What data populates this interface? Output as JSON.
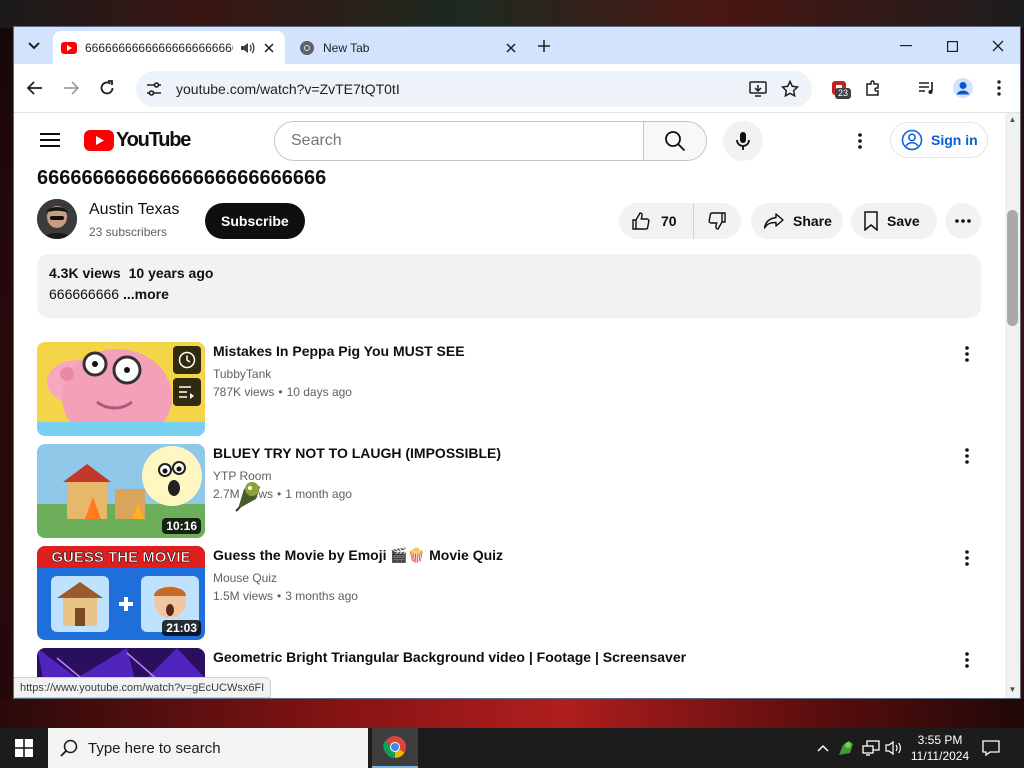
{
  "browser": {
    "tabs": [
      {
        "title": "66666666666666666666666666",
        "active": true,
        "audio": true
      },
      {
        "title": "New Tab",
        "active": false
      }
    ],
    "url": "youtube.com/watch?v=ZvTE7tQT0tI",
    "extension_badge": "23",
    "status_url": "https://www.youtube.com/watch?v=gEcUCWsx6FI"
  },
  "youtube": {
    "logo_text": "YouTube",
    "search_placeholder": "Search",
    "sign_in": "Sign in",
    "video": {
      "title": "66666666666666666666666666",
      "channel": "Austin Texas",
      "subscribers": "23 subscribers",
      "subscribe_label": "Subscribe",
      "likes": "70",
      "share_label": "Share",
      "save_label": "Save",
      "views": "4.3K views",
      "age": "10 years ago",
      "description": "666666666",
      "more_label": "...more"
    },
    "recommendations": [
      {
        "title": "Mistakes In Peppa Pig You MUST SEE",
        "channel": "TubbyTank",
        "views": "787K views",
        "age": "10 days ago",
        "duration": ""
      },
      {
        "title": "BLUEY TRY NOT TO LAUGH (IMPOSSIBLE)",
        "channel": "YTP Room",
        "views": "2.7M views",
        "age": "1 month ago",
        "duration": "10:16"
      },
      {
        "title": "Guess the Movie by Emoji 🎬🍿 Movie Quiz",
        "channel": "Mouse Quiz",
        "views": "1.5M views",
        "age": "3 months ago",
        "duration": "21:03",
        "thumb_text": "GUESS THE MOVIE"
      },
      {
        "title": "Geometric Bright Triangular Background video | Footage | Screensaver",
        "channel": "",
        "views": "",
        "age": "",
        "duration": ""
      }
    ],
    "colors": {
      "brand_red": "#ff0000",
      "link_blue": "#065fd4"
    }
  },
  "taskbar": {
    "search_placeholder": "Type here to search",
    "time": "3:55 PM",
    "date": "11/11/2024"
  }
}
